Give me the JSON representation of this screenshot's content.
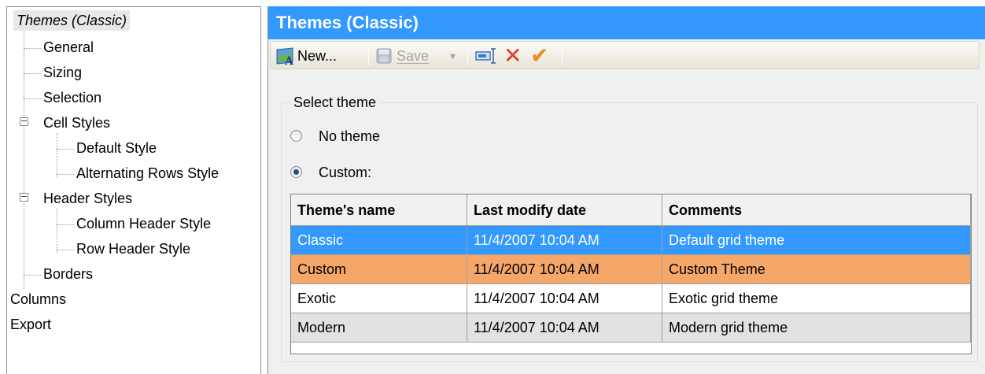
{
  "tree": {
    "items": [
      {
        "label": "Themes (Classic)"
      },
      {
        "label": "General"
      },
      {
        "label": "Sizing"
      },
      {
        "label": "Selection"
      },
      {
        "label": "Cell Styles"
      },
      {
        "label": "Default Style"
      },
      {
        "label": "Alternating Rows Style"
      },
      {
        "label": "Header Styles"
      },
      {
        "label": "Column Header Style"
      },
      {
        "label": "Row Header Style"
      },
      {
        "label": "Borders"
      },
      {
        "label": "Columns"
      },
      {
        "label": "Export"
      }
    ],
    "expander_symbol": "−"
  },
  "panel": {
    "title": "Themes (Classic)"
  },
  "toolbar": {
    "new_label": "New...",
    "save_label": "Save",
    "dropdown_glyph": "▾",
    "delete_glyph": "✕",
    "apply_glyph": "✔"
  },
  "select_theme": {
    "group_title": "Select theme",
    "option_no_theme": "No theme",
    "option_custom": "Custom:",
    "selected": "Custom:"
  },
  "grid": {
    "columns": [
      "Theme's name",
      "Last modify date",
      "Comments"
    ],
    "rows": [
      {
        "name": "Classic",
        "date": "11/4/2007 10:04 AM",
        "comment": "Default grid theme",
        "bg": "#3399ff",
        "fg": "#ffffff"
      },
      {
        "name": "Custom",
        "date": "11/4/2007 10:04 AM",
        "comment": "Custom Theme",
        "bg": "#f5a76a",
        "fg": "#000000"
      },
      {
        "name": "Exotic",
        "date": "11/4/2007 10:04 AM",
        "comment": "Exotic grid theme",
        "bg": "#ffffff",
        "fg": "#000000"
      },
      {
        "name": "Modern",
        "date": "11/4/2007 10:04 AM",
        "comment": "Modern grid theme",
        "bg": "#e2e2e2",
        "fg": "#000000"
      }
    ]
  },
  "colors": {
    "accent": "#3399ff",
    "custom_row": "#f5a76a",
    "delete_icon": "#e03a2c",
    "apply_icon": "#f08a20"
  }
}
